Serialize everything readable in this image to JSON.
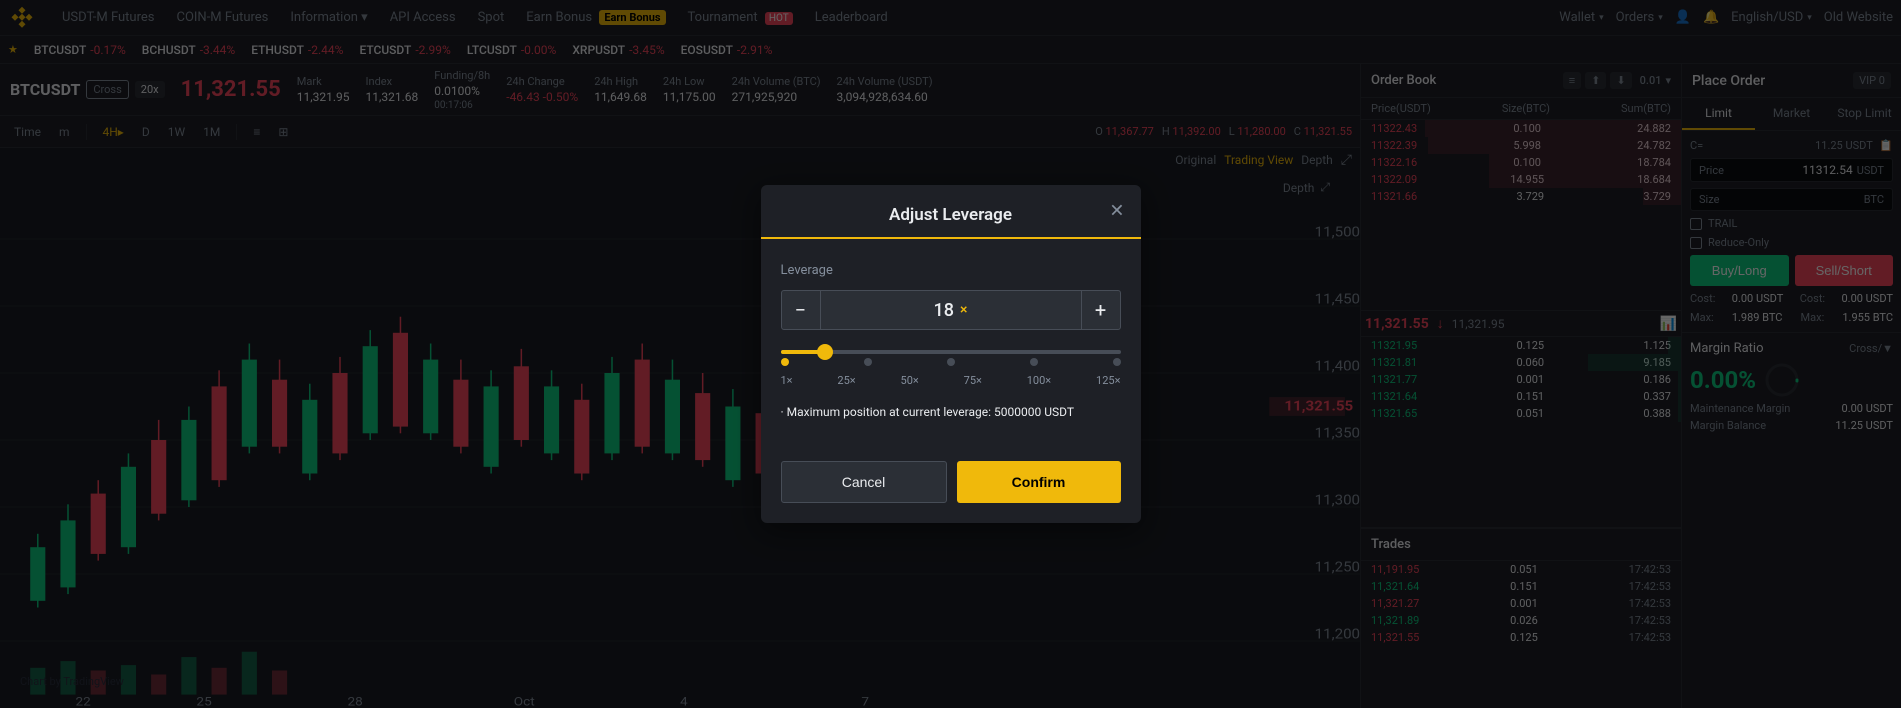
{
  "nav": {
    "logo_alt": "Binance Logo",
    "items": [
      {
        "id": "usdt-m-futures",
        "label": "USDT-M Futures"
      },
      {
        "id": "coin-m-futures",
        "label": "COIN-M Futures"
      },
      {
        "id": "information",
        "label": "Information",
        "arrow": true
      },
      {
        "id": "api-access",
        "label": "API Access"
      },
      {
        "id": "spot",
        "label": "Spot"
      },
      {
        "id": "earn-bonus",
        "label": "Earn Bonus",
        "badge": "earn"
      },
      {
        "id": "tournament",
        "label": "Tournament",
        "badge": "hot"
      },
      {
        "id": "leaderboard",
        "label": "Leaderboard"
      }
    ],
    "right_items": [
      {
        "id": "wallet",
        "label": "Wallet",
        "arrow": true
      },
      {
        "id": "orders",
        "label": "Orders",
        "arrow": true
      },
      {
        "id": "account",
        "label": ""
      },
      {
        "id": "notifications",
        "label": ""
      },
      {
        "id": "language",
        "label": "English/USD",
        "arrow": true
      },
      {
        "id": "old-website",
        "label": "Old Website"
      }
    ]
  },
  "ticker": {
    "star": "★",
    "items": [
      {
        "name": "BTCUSDT",
        "change": "-0.17%",
        "negative": true
      },
      {
        "name": "BCHUSDT",
        "change": "-3.44%",
        "negative": true
      },
      {
        "name": "ETHUSDT",
        "change": "-2.44%",
        "negative": true
      },
      {
        "name": "ETCUSDT",
        "change": "-2.99%",
        "negative": true
      },
      {
        "name": "LTCUSDT",
        "change": "-0.00%",
        "negative": true
      },
      {
        "name": "XRPUSDT",
        "change": "-3.45%",
        "negative": true
      },
      {
        "name": "EOSUSDT",
        "change": "-2.91%",
        "negative": true
      }
    ]
  },
  "symbol": {
    "name": "BTCUSDT",
    "cross": "Cross",
    "leverage": "20x",
    "price": "11,321.55",
    "stats": [
      {
        "label": "Mark",
        "value": "11,321.95",
        "negative": false
      },
      {
        "label": "Index",
        "value": "11,321.68",
        "negative": false
      },
      {
        "label": "Funding/8h",
        "value": "0.0100%",
        "extra": "00:17:06",
        "negative": false
      },
      {
        "label": "24h Change",
        "value": "-46.43 -0.50%",
        "negative": true
      },
      {
        "label": "24h High",
        "value": "11,649.68",
        "negative": false
      },
      {
        "label": "24h Low",
        "value": "11,175.00",
        "negative": false
      },
      {
        "label": "24h Volume (BTC)",
        "value": "271,925,920",
        "negative": false
      },
      {
        "label": "24h Volume (USDT)",
        "value": "3,094,928,634.60",
        "negative": false
      }
    ]
  },
  "chart": {
    "toolbar": {
      "time_options": [
        "m",
        "4H",
        "D",
        "1W",
        "1M"
      ],
      "active_time": "4H",
      "view_options": [
        "Original",
        "Trading View",
        "Depth"
      ],
      "active_view": "Trading View"
    },
    "ohlc": {
      "o": "11,367.77",
      "h": "11,392.00",
      "l": "11,280.00",
      "c": "11,321.55"
    },
    "watermark": "Chart by TradingView",
    "depth_label": "Depth"
  },
  "order_book": {
    "title": "Order Book",
    "controls": [
      "",
      "",
      ""
    ],
    "decimal": "0.01",
    "col_headers": [
      "Price(USDT)",
      "Size(BTC)",
      "Sum(BTC)"
    ],
    "ask_rows": [
      {
        "price": "11322.43",
        "size": "0.100",
        "sum": "24.882",
        "bar_pct": 80
      },
      {
        "price": "11322.39",
        "size": "5.998",
        "sum": "24.782",
        "bar_pct": 79
      },
      {
        "price": "11322.16",
        "size": "0.100",
        "sum": "18.784",
        "bar_pct": 60
      },
      {
        "price": "11322.09",
        "size": "14.955",
        "sum": "18.684",
        "bar_pct": 60
      },
      {
        "price": "11321.66",
        "size": "3.729",
        "sum": "3.729",
        "bar_pct": 12
      }
    ],
    "current_price": "11,321.55",
    "current_price_arrow": "↓",
    "current_price_usd": "11,321.95",
    "bid_rows": [
      {
        "price": "11321.95",
        "size": "0.125",
        "sum": "1.125",
        "bar_pct": 4
      },
      {
        "price": "11321.81",
        "size": "0.060",
        "sum": "9.185",
        "bar_pct": 29
      },
      {
        "price": "11321.77",
        "size": "0.001",
        "sum": "0.186",
        "bar_pct": 1
      },
      {
        "price": "11321.64",
        "size": "0.151",
        "sum": "0.337",
        "bar_pct": 1
      },
      {
        "price": "11321.65",
        "size": "0.051",
        "sum": "0.388",
        "bar_pct": 1
      }
    ]
  },
  "trades": {
    "title": "Trades",
    "rows": [
      {
        "price": "11,191.95",
        "size": "0.051",
        "time": "17:42:53",
        "negative": true
      },
      {
        "price": "11,321.64",
        "size": "0.151",
        "time": "17:42:53",
        "negative": false
      },
      {
        "price": "11,321.27",
        "size": "0.001",
        "time": "17:42:53",
        "negative": true
      },
      {
        "price": "11,321.89",
        "size": "0.026",
        "time": "17:42:53",
        "negative": false
      },
      {
        "price": "11,321.55",
        "size": "0.125",
        "time": "17:42:53",
        "negative": true
      }
    ]
  },
  "place_order": {
    "title": "Place Order",
    "vip": "VIP 0",
    "tabs": [
      {
        "id": "limit",
        "label": "Limit",
        "active": true
      },
      {
        "id": "market",
        "label": "Market"
      },
      {
        "id": "stop-limit",
        "label": "Stop Limit"
      }
    ],
    "available_label": "C=",
    "available_value": "11.25",
    "available_unit": "USDT",
    "price_label": "Price",
    "price_value": "11312.54",
    "price_unit": "USDT",
    "size_label": "Size",
    "size_value": "",
    "size_unit": "BTC",
    "checkboxes": [
      {
        "id": "trail",
        "label": "TRAIL"
      },
      {
        "id": "reduce-only",
        "label": "Reduce-Only"
      }
    ],
    "buy_label": "Buy/Long",
    "sell_label": "Sell/Short",
    "cost_buy": {
      "label": "Cost:",
      "value": "0.00 USDT"
    },
    "max_buy": {
      "label": "Max:",
      "value": "1.989 BTC"
    },
    "cost_sell": {
      "label": "Cost:",
      "value": "0.00 USDT"
    },
    "max_sell": {
      "label": "Max:",
      "value": "1.955 BTC"
    }
  },
  "margin_ratio": {
    "title": "Margin Ratio",
    "toggle": "Cross/▼",
    "ratio_value": "0.00%",
    "maintenance_label": "Maintenance Margin",
    "maintenance_value": "0.00 USDT",
    "balance_label": "Margin Balance",
    "balance_value": "11.25 USDT"
  },
  "modal": {
    "title": "Adjust Leverage",
    "leverage_label": "Leverage",
    "leverage_value": "18",
    "leverage_suffix": "×",
    "slider_pct": 13,
    "marks": [
      "1×",
      "25×",
      "50×",
      "75×",
      "100×",
      "125×"
    ],
    "info_prefix": "· Maximum position at current leverage: ",
    "info_value": "5000000",
    "info_suffix": " USDT",
    "cancel_label": "Cancel",
    "confirm_label": "Confirm"
  }
}
